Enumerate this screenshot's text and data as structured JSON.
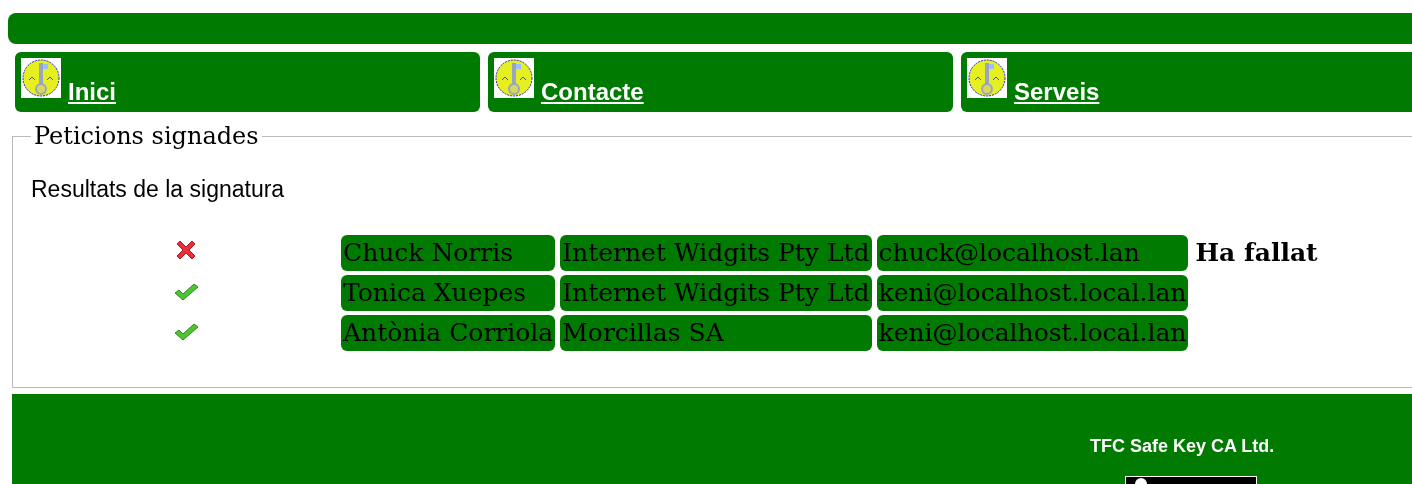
{
  "nav": [
    {
      "label": "Inici"
    },
    {
      "label": "Contacte"
    },
    {
      "label": "Serveis"
    }
  ],
  "section": {
    "legend": "Peticions signades",
    "heading": "Resultats de la signatura"
  },
  "rows": [
    {
      "kind": "failed",
      "name": "Chuck Norris",
      "organization": "Internet Widgits Pty Ltd",
      "email": "chuck@localhost.lan",
      "result": "Ha fallat"
    },
    {
      "kind": "ok",
      "name": "Tonica Xuepes",
      "organization": "Internet Widgits Pty Ltd",
      "email": "keni@localhost.local.lan"
    },
    {
      "kind": "ok",
      "name": "Antònia Corriola",
      "organization": "Morcillas SA",
      "email": "keni@localhost.local.lan"
    }
  ],
  "footer": {
    "company": "TFC Safe Key CA Ltd."
  }
}
